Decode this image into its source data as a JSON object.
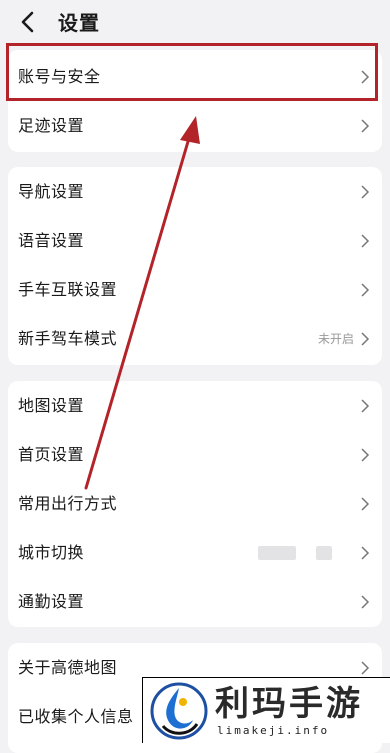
{
  "header": {
    "title": "设置"
  },
  "sections": [
    {
      "items": [
        {
          "label": "账号与安全"
        },
        {
          "label": "足迹设置"
        }
      ]
    },
    {
      "items": [
        {
          "label": "导航设置"
        },
        {
          "label": "语音设置"
        },
        {
          "label": "手车互联设置"
        },
        {
          "label": "新手驾车模式",
          "value": "未开启"
        }
      ]
    },
    {
      "items": [
        {
          "label": "地图设置"
        },
        {
          "label": "首页设置"
        },
        {
          "label": "常用出行方式"
        },
        {
          "label": "城市切换"
        },
        {
          "label": "通勤设置"
        }
      ]
    },
    {
      "items": [
        {
          "label": "关于高德地图"
        },
        {
          "label": "已收集个人信息"
        }
      ]
    }
  ],
  "watermark": {
    "text": "利玛手游",
    "sub": "limakeji.info"
  },
  "colors": {
    "highlight": "#b3242a",
    "background": "#f2f2f4",
    "card": "#ffffff"
  }
}
